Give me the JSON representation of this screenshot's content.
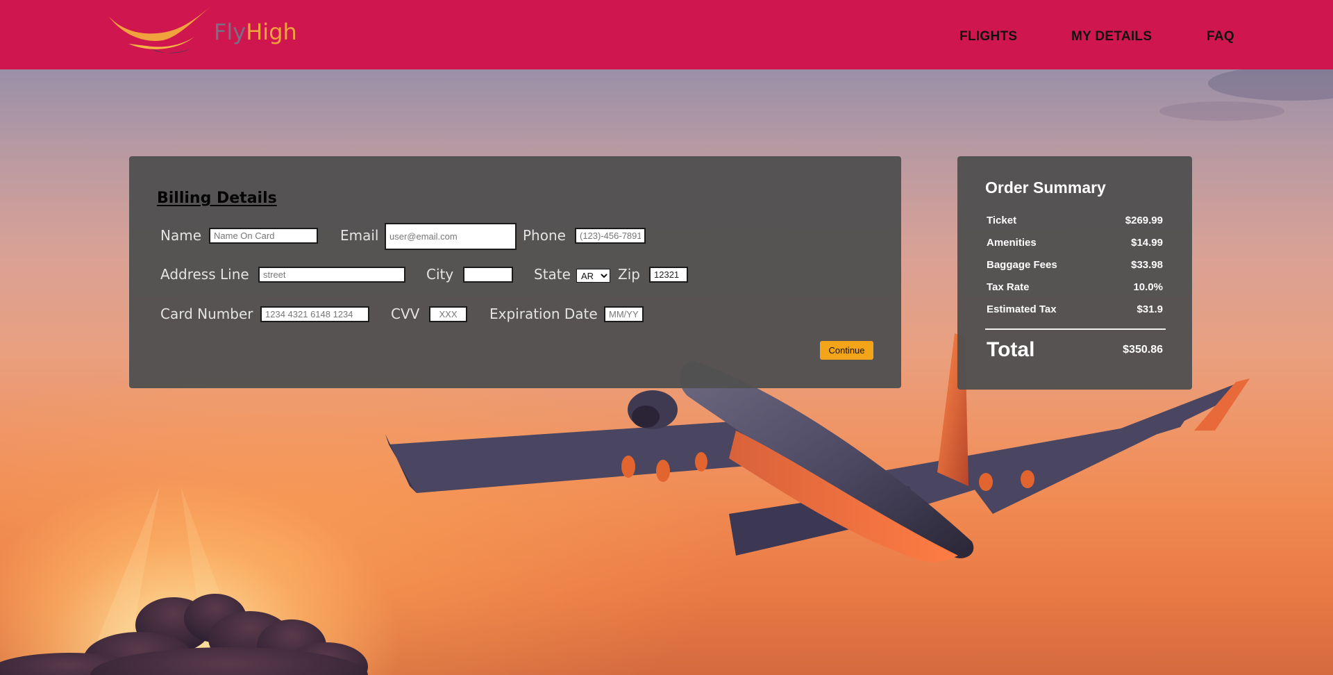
{
  "brand": {
    "name_part1": "Fly",
    "name_part2": "High",
    "primary_color": "#d0164f",
    "accent_color": "#f0a33c"
  },
  "nav": {
    "flights": "FLIGHTS",
    "my_details": "MY DETAILS",
    "faq": "FAQ"
  },
  "billing": {
    "title": "Billing Details",
    "name": {
      "label": "Name",
      "placeholder": "Name On Card",
      "value": ""
    },
    "email": {
      "label": "Email",
      "placeholder": "user@email.com",
      "value": ""
    },
    "phone": {
      "label": "Phone",
      "placeholder": "(123)-456-7891",
      "value": ""
    },
    "address": {
      "label": "Address Line",
      "placeholder": "street",
      "value": ""
    },
    "city": {
      "label": "City",
      "placeholder": "",
      "value": ""
    },
    "state": {
      "label": "State",
      "selected": "AR"
    },
    "zip": {
      "label": "Zip",
      "placeholder": "",
      "value": "12321"
    },
    "card_number": {
      "label": "Card Number",
      "placeholder": "1234 4321 6148 1234",
      "value": ""
    },
    "cvv": {
      "label": "CVV",
      "placeholder": "XXX",
      "value": ""
    },
    "expiration": {
      "label": "Expiration Date",
      "placeholder": "MM/YY",
      "value": ""
    },
    "continue_label": "Continue",
    "continue_color": "#f4a419"
  },
  "summary": {
    "title": "Order Summary",
    "rows": [
      {
        "label": "Ticket",
        "value": "$269.99"
      },
      {
        "label": "Amenities",
        "value": "$14.99"
      },
      {
        "label": "Baggage Fees",
        "value": "$33.98"
      },
      {
        "label": "Tax Rate",
        "value": "10.0%"
      },
      {
        "label": "Estimated Tax",
        "value": "$31.9"
      }
    ],
    "total_label": "Total",
    "total_value": "$350.86"
  }
}
